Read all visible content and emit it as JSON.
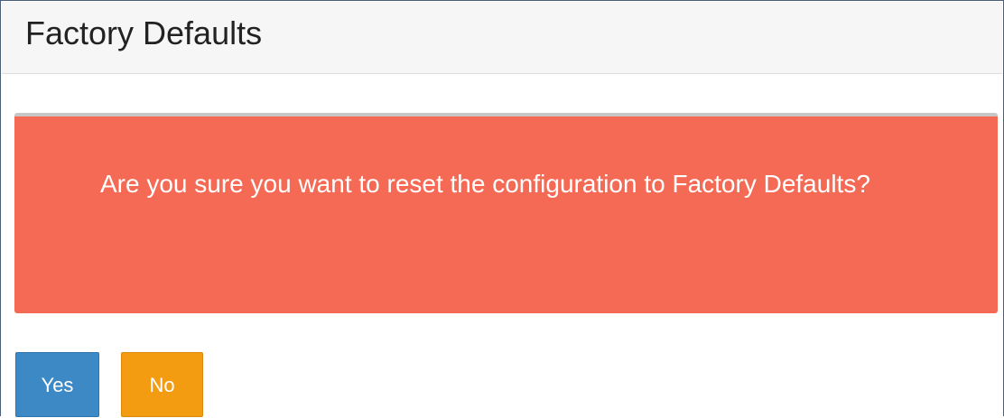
{
  "page": {
    "title": "Factory Defaults"
  },
  "alert": {
    "message": "Are you sure you want to reset the configuration to Factory Defaults?"
  },
  "actions": {
    "yes_label": "Yes",
    "no_label": "No"
  },
  "colors": {
    "alert_background": "#f46a55",
    "yes_button": "#3c89c5",
    "no_button": "#f39c12",
    "header_background": "#f6f6f6"
  }
}
